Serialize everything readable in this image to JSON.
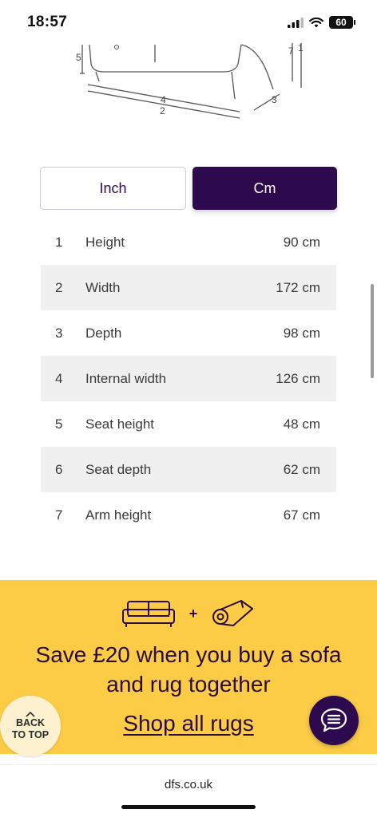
{
  "status": {
    "time": "18:57",
    "battery": "60"
  },
  "diagram": {
    "labels": [
      "5",
      "4",
      "2",
      "3",
      "7",
      "1"
    ]
  },
  "unit_toggle": {
    "inch": "Inch",
    "cm": "Cm",
    "selected": "Cm"
  },
  "dimensions": [
    {
      "num": "1",
      "label": "Height",
      "value": "90 cm"
    },
    {
      "num": "2",
      "label": "Width",
      "value": "172 cm"
    },
    {
      "num": "3",
      "label": "Depth",
      "value": "98 cm"
    },
    {
      "num": "4",
      "label": "Internal width",
      "value": "126 cm"
    },
    {
      "num": "5",
      "label": "Seat height",
      "value": "48 cm"
    },
    {
      "num": "6",
      "label": "Seat depth",
      "value": "62 cm"
    },
    {
      "num": "7",
      "label": "Arm height",
      "value": "67 cm"
    }
  ],
  "promo": {
    "plus": "+",
    "line1": "Save £20 when you buy a sofa",
    "line2": "and rug together",
    "link": "Shop all rugs"
  },
  "back_to_top": {
    "line1": "BACK",
    "line2": "TO TOP"
  },
  "browser": {
    "url": "dfs.co.uk"
  },
  "colors": {
    "brand_purple": "#2d0a4e",
    "promo_yellow": "#fdcc47",
    "row_alt": "#f0f0f0"
  }
}
